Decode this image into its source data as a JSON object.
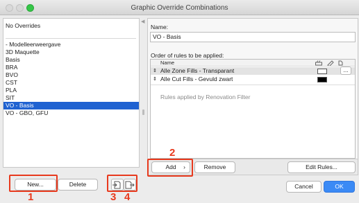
{
  "window": {
    "title": "Graphic Override Combinations"
  },
  "left_list": {
    "header": "No Overrides",
    "items": [
      {
        "label": "- Modelleerweergave"
      },
      {
        "label": "3D Maquette"
      },
      {
        "label": "Basis"
      },
      {
        "label": "BRA"
      },
      {
        "label": "BVO"
      },
      {
        "label": "CST"
      },
      {
        "label": "PLA"
      },
      {
        "label": "SIT"
      },
      {
        "label": "VO - Basis",
        "selected": true
      },
      {
        "label": "VO - GBO, GFU"
      }
    ]
  },
  "left_buttons": {
    "new": "New...",
    "delete": "Delete",
    "import_icon": "import-icon",
    "export_icon": "export-icon"
  },
  "name_label": "Name:",
  "name_value": "VO - Basis",
  "rules_label": "Order of rules to be applied:",
  "rules_table": {
    "header_name": "Name",
    "header_icons": [
      "fill-pattern-icon",
      "pen-color-icon",
      "background-color-icon"
    ],
    "rows": [
      {
        "name": "Alle Zone Fills - Transparant",
        "swatch_color": "#ffffff",
        "selected": true
      },
      {
        "name": "Alle Cut Fills - Gevuld zwart",
        "swatch_color": "#000000",
        "selected": false
      }
    ],
    "renovation_note": "Rules applied by Renovation Filter"
  },
  "rule_buttons": {
    "add": "Add",
    "add_chevron": "›",
    "remove": "Remove",
    "edit_rules": "Edit Rules...",
    "more": "..."
  },
  "dialog_buttons": {
    "cancel": "Cancel",
    "ok": "OK"
  },
  "annotations": {
    "n1": "1",
    "n2": "2",
    "n3": "3",
    "n4": "4"
  },
  "colors": {
    "accent": "#1f62d1",
    "ok_blue": "#3b8af5",
    "annotation_red": "#e8391d"
  }
}
